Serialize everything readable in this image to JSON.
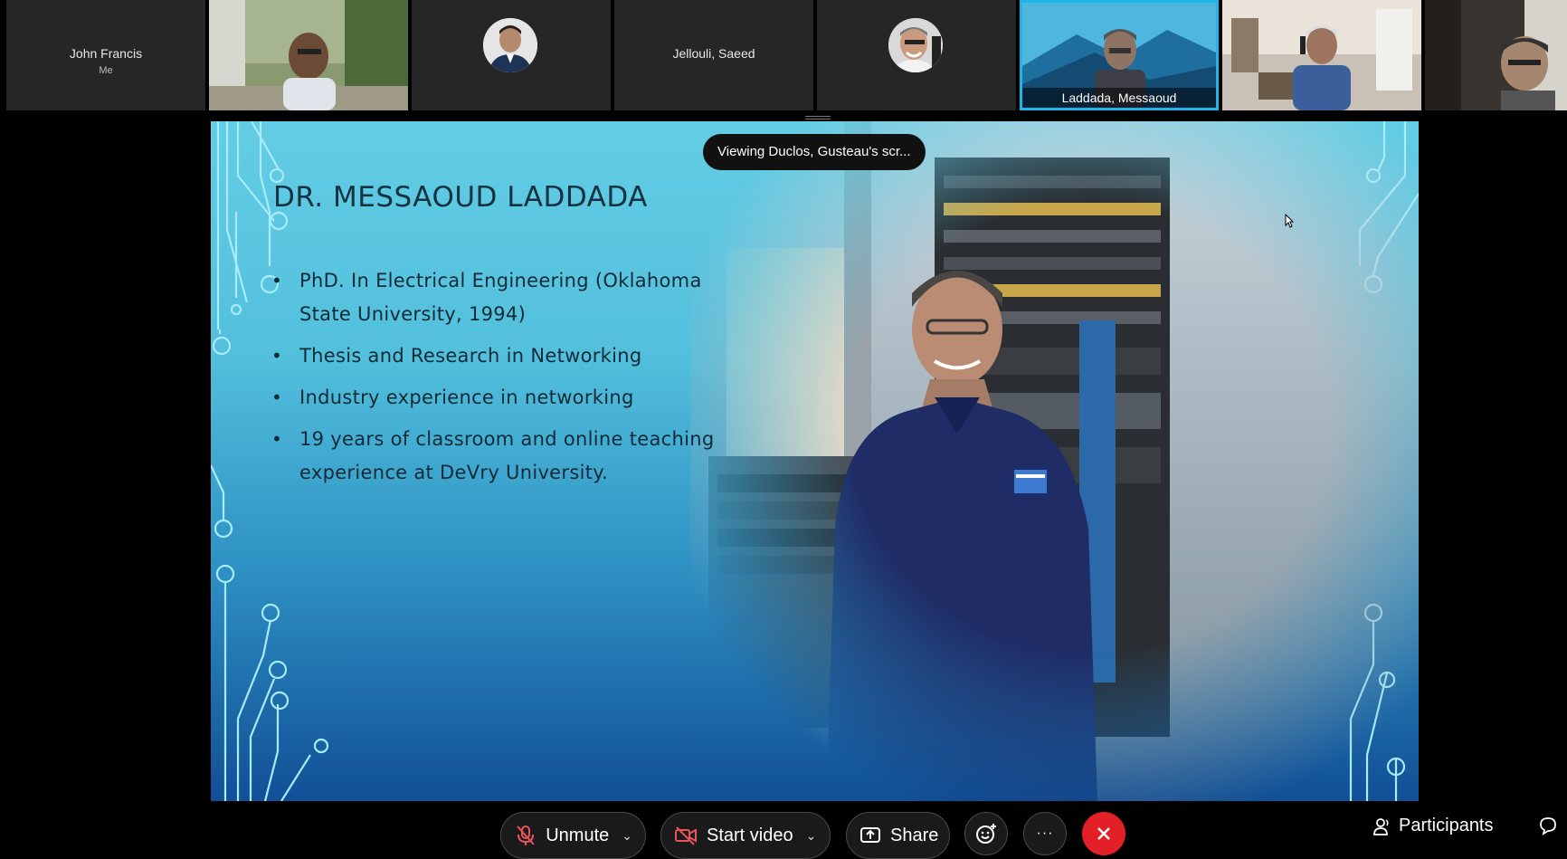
{
  "participants": [
    {
      "name": "John Francis",
      "sub": "Me"
    },
    {
      "name": ""
    },
    {
      "name": ""
    },
    {
      "name": "Jellouli, Saeed"
    },
    {
      "name": ""
    },
    {
      "name": "Laddada, Messaoud",
      "active": true
    },
    {
      "name": ""
    },
    {
      "name": ""
    }
  ],
  "overlay": {
    "viewing_label": "Viewing Duclos, Gusteau's scr..."
  },
  "slide": {
    "title": "DR. MESSAOUD LADDADA",
    "bullets": [
      "PhD. In Electrical Engineering  (Oklahoma State University, 1994)",
      "Thesis and Research in Networking",
      "Industry experience in networking",
      "19 years of classroom and online teaching experience at DeVry University."
    ]
  },
  "toolbar": {
    "unmute_label": "Unmute",
    "video_label": "Start video",
    "share_label": "Share",
    "more_label": "···",
    "participants_label": "Participants"
  },
  "colors": {
    "active_border": "#1fb5ea",
    "end_call": "#e32028",
    "muted_icon": "#e8555a",
    "slide_text": "#102b37"
  },
  "icons": [
    "mic-muted-icon",
    "video-off-icon",
    "share-icon",
    "reactions-icon",
    "more-icon",
    "end-call-icon",
    "participants-icon",
    "chat-icon",
    "cursor-icon"
  ]
}
